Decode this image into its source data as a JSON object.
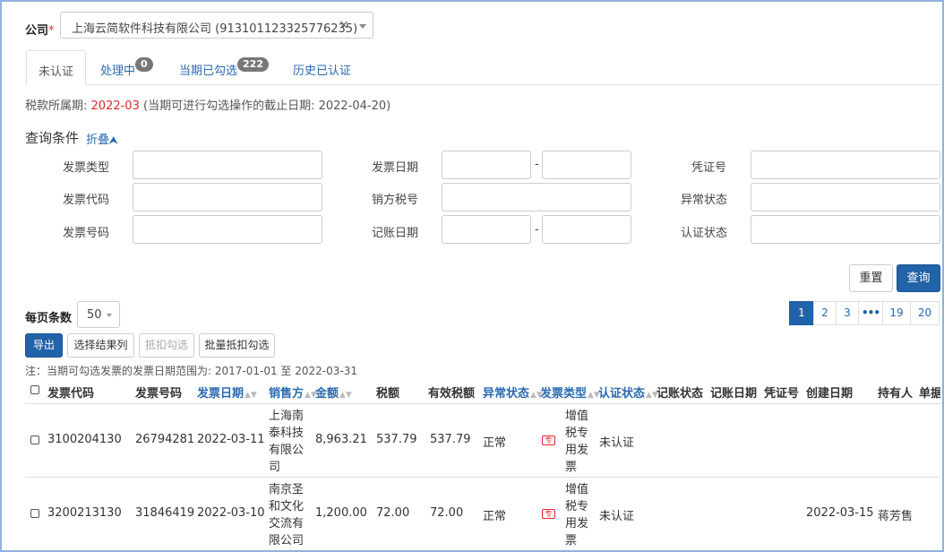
{
  "company": {
    "label": "公司",
    "required_mark": "*",
    "selected": "上海云简软件科技有限公司 (913101123325776235)",
    "clear_glyph": "×"
  },
  "tabs": [
    {
      "label": "未认证",
      "badge": null
    },
    {
      "label": "处理中",
      "badge": "0"
    },
    {
      "label": "当期已勾选",
      "badge": "222"
    },
    {
      "label": "历史已认证",
      "badge": null
    }
  ],
  "tax_period": {
    "label": "税款所属期:",
    "value": "2022-03",
    "deadline_prefix": "(当期可进行勾选操作的截止日期:",
    "deadline": "2022-04-20",
    "deadline_suffix": ")"
  },
  "query": {
    "title": "查询条件",
    "fold": "折叠",
    "fields": {
      "invoice_type": "发票类型",
      "invoice_date": "发票日期",
      "voucher_no": "凭证号",
      "invoice_code": "发票代码",
      "seller_tax_no": "销方税号",
      "abnormal_status": "异常状态",
      "invoice_no": "发票号码",
      "booking_date": "记账日期",
      "auth_status": "认证状态"
    },
    "range_sep": "-",
    "reset": "重置",
    "search": "查询"
  },
  "page_size": {
    "label": "每页条数",
    "value": "50"
  },
  "pagination": {
    "pages": [
      "1",
      "2",
      "3",
      "•••",
      "19",
      "20"
    ],
    "active": "1"
  },
  "toolbar": {
    "export": "导出",
    "select_columns": "选择结果列",
    "deduct_select": "抵扣勾选",
    "batch_deduct": "批量抵扣勾选"
  },
  "note": "注：当期可勾选发票的发票日期范围为: 2017-01-01 至 2022-03-31",
  "table": {
    "columns": {
      "code": "发票代码",
      "number": "发票号码",
      "date": "发票日期",
      "seller": "销售方",
      "amount": "金额",
      "tax": "税额",
      "valid_tax": "有效税额",
      "abnormal": "异常状态",
      "type": "发票类型",
      "auth": "认证状态",
      "booking_status": "记账状态",
      "booking_date": "记账日期",
      "voucher": "凭证号",
      "created": "创建日期",
      "holder": "持有人",
      "unit": "单据"
    },
    "rows": [
      {
        "code": "3100204130",
        "number": "26794281",
        "date": "2022-03-11",
        "seller": "上海南泰科技有限公司",
        "amount": "8,963.21",
        "tax": "537.79",
        "valid_tax": "537.79",
        "abnormal": "正常",
        "type_icon": "专",
        "type": "增值税专用发票",
        "auth": "未认证",
        "created": "",
        "holder": ""
      },
      {
        "code": "3200213130",
        "number": "31846419",
        "date": "2022-03-10",
        "seller": "南京圣和文化交流有限公司",
        "amount": "1,200.00",
        "tax": "72.00",
        "valid_tax": "72.00",
        "abnormal": "正常",
        "type_icon": "专",
        "type": "增值税专用发票",
        "auth": "未认证",
        "created": "2022-03-15",
        "holder": "蒋芳售"
      }
    ]
  }
}
